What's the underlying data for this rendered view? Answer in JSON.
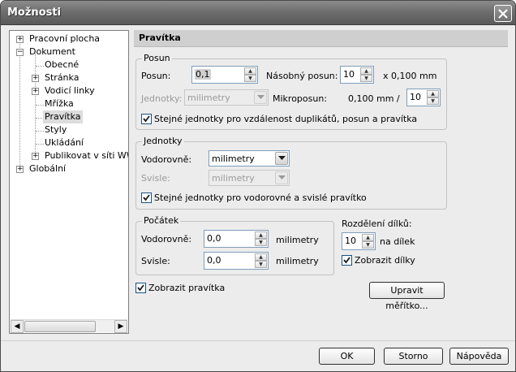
{
  "window": {
    "title": "Možnosti"
  },
  "tree": {
    "items": [
      {
        "label": "Pracovní plocha",
        "expander": "+"
      },
      {
        "label": "Dokument",
        "expander": "−"
      },
      {
        "label": "Obecné"
      },
      {
        "label": "Stránka",
        "expander": "+"
      },
      {
        "label": "Vodicí linky",
        "expander": "+"
      },
      {
        "label": "Mřížka"
      },
      {
        "label": "Pravítka",
        "selected": true
      },
      {
        "label": "Styly"
      },
      {
        "label": "Ukládání"
      },
      {
        "label": "Publikovat v síti WWW",
        "expander": "+"
      },
      {
        "label": "Globální",
        "expander": "+"
      }
    ]
  },
  "panel": {
    "title": "Pravítka"
  },
  "posun": {
    "title": "Posun",
    "posun_label": "Posun:",
    "posun_value": "0,1",
    "nasobny_label": "Násobný posun:",
    "nasobny_value": "10",
    "nasobny_unit": "x 0,100 mm",
    "jednotky_label": "Jednotky:",
    "jednotky_value": "milimetry",
    "mikro_label": "Mikroposun:",
    "mikro_unit": "0,100 mm /",
    "mikro_value": "10",
    "same_units_label": "Stejné jednotky pro vzdálenost duplikátů, posun a pravítka"
  },
  "jednotky": {
    "title": "Jednotky",
    "horiz_label": "Vodorovně:",
    "horiz_value": "milimetry",
    "vert_label": "Svisle:",
    "vert_value": "milimetry",
    "same_units_label": "Stejné jednotky pro vodorovné a svislé pravítko"
  },
  "pocatek": {
    "title": "Počátek",
    "horiz_label": "Vodorovně:",
    "horiz_value": "0,0",
    "horiz_unit": "milimetry",
    "vert_label": "Svisle:",
    "vert_value": "0,0",
    "vert_unit": "milimetry"
  },
  "deleni": {
    "title": "Rozdělení dílků:",
    "value": "10",
    "unit": "na dílek",
    "show_label": "Zobrazit dílky"
  },
  "show_rulers_label": "Zobrazit pravítka",
  "scale_button": "Upravit měřítko...",
  "buttons": {
    "ok": "OK",
    "cancel": "Storno",
    "help": "Nápověda"
  }
}
